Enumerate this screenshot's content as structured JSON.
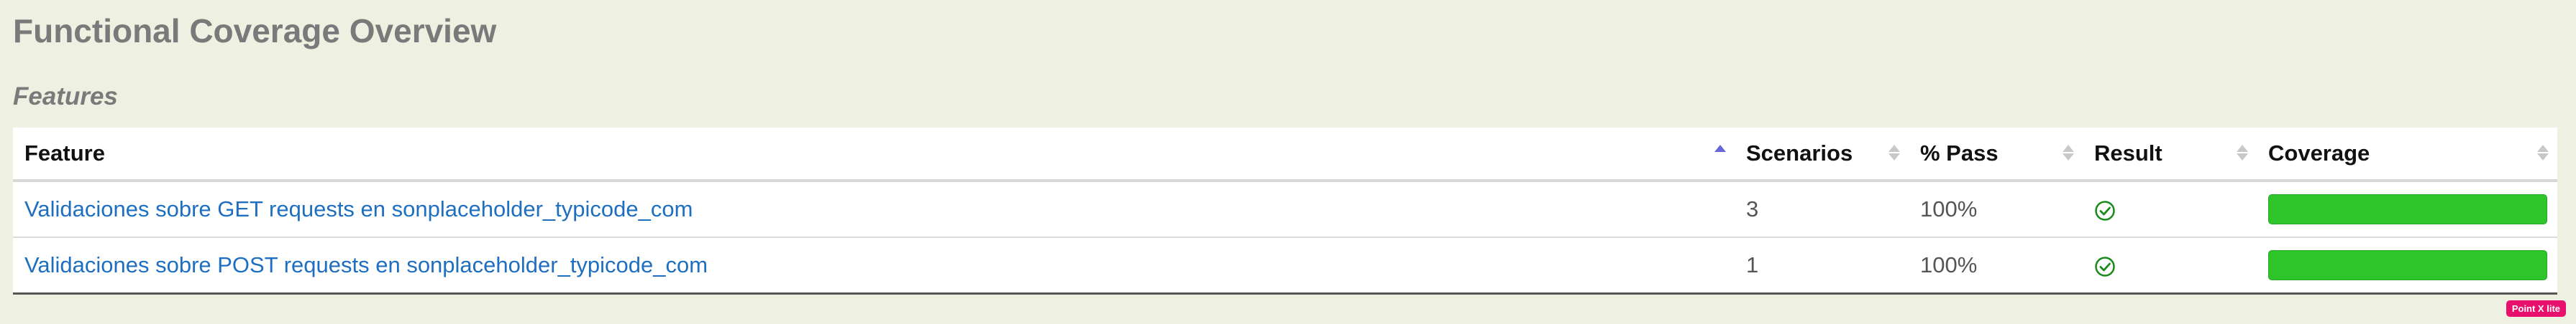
{
  "page_title": "Functional Coverage Overview",
  "section_title": "Features",
  "table": {
    "headers": {
      "feature": "Feature",
      "scenarios": "Scenarios",
      "pass": "% Pass",
      "result": "Result",
      "coverage": "Coverage"
    },
    "rows": [
      {
        "feature": "Validaciones sobre GET requests en sonplaceholder_typicode_com",
        "scenarios": "3",
        "pass": "100%",
        "result_icon": "check-circle-icon",
        "coverage": 1.0
      },
      {
        "feature": "Validaciones sobre POST requests en sonplaceholder_typicode_com",
        "scenarios": "1",
        "pass": "100%",
        "result_icon": "check-circle-icon",
        "coverage": 1.0
      }
    ]
  },
  "badge": "Point X lite",
  "colors": {
    "background": "#eef0e2",
    "link": "#1f6fc1",
    "coverage_bar": "#2ec52a",
    "pass_icon": "#1a8a1a"
  }
}
